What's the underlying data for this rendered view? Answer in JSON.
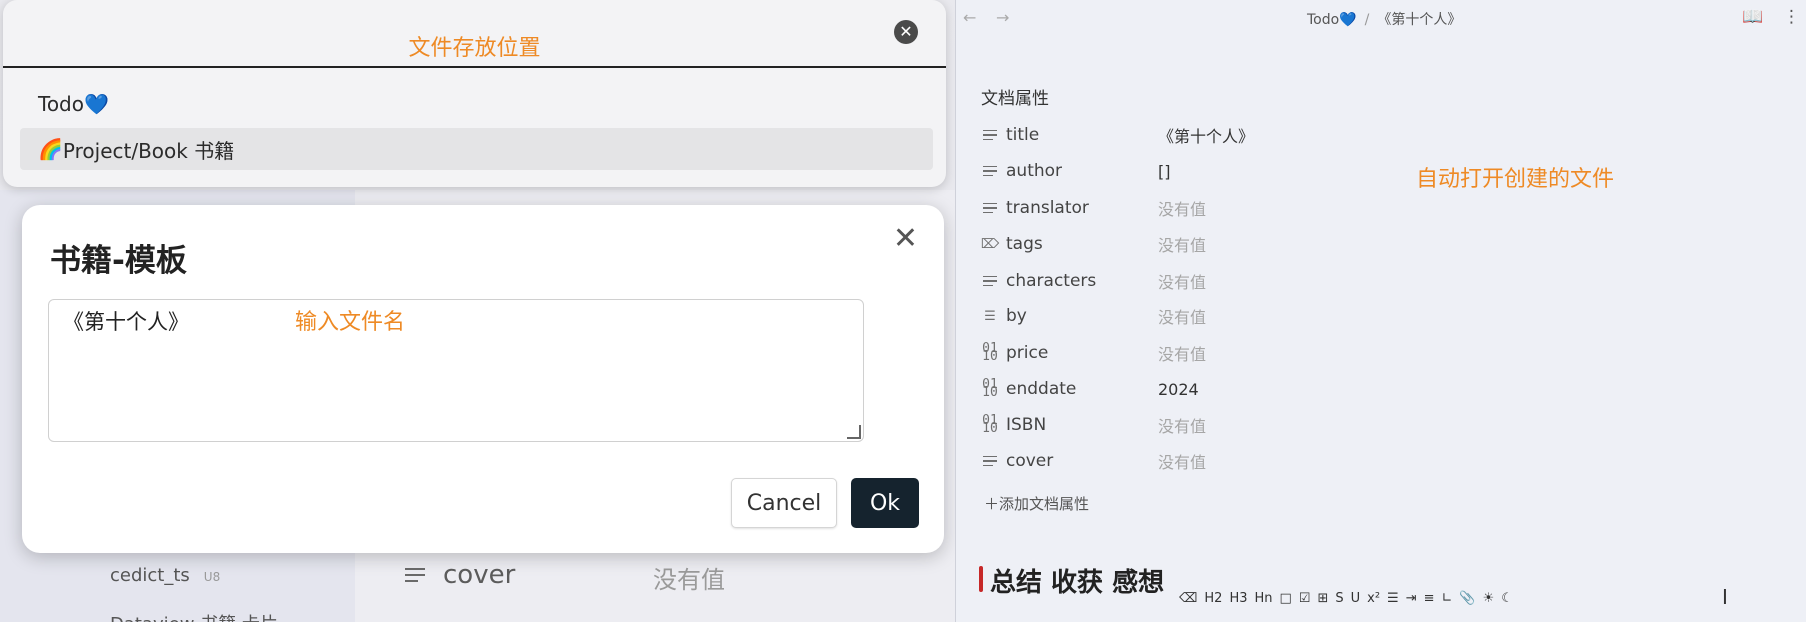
{
  "location_picker": {
    "title": "文件存放位置",
    "items": [
      {
        "label": "Todo",
        "emoji": "💙"
      },
      {
        "label": "Project/Book 书籍",
        "emoji": "🌈"
      }
    ]
  },
  "template_modal": {
    "title": "书籍-模板",
    "filename_value": "《第十个人》",
    "hint": "输入文件名",
    "cancel_label": "Cancel",
    "ok_label": "Ok"
  },
  "background": {
    "file_item_1": "cedict_ts",
    "file_item_1_badge": "U8",
    "file_item_2": "Dataview 书籍 卡片",
    "prop_name": "cover",
    "prop_value": "没有值"
  },
  "right_pane": {
    "breadcrumb": {
      "parent": "Todo💙",
      "separator": "/",
      "current": "《第十个人》"
    },
    "properties_heading": "文档属性",
    "properties": [
      {
        "name": "title",
        "value": "《第十个人》",
        "icon": "text-lines-icon",
        "empty": false
      },
      {
        "name": "author",
        "value": "[]",
        "icon": "text-lines-icon",
        "empty": false
      },
      {
        "name": "translator",
        "value": "没有值",
        "icon": "text-lines-icon",
        "empty": true
      },
      {
        "name": "tags",
        "value": "没有值",
        "icon": "tag-icon",
        "empty": true
      },
      {
        "name": "characters",
        "value": "没有值",
        "icon": "text-lines-icon",
        "empty": true
      },
      {
        "name": "by",
        "value": "没有值",
        "icon": "list-icon",
        "empty": true
      },
      {
        "name": "price",
        "value": "没有值",
        "icon": "number-icon",
        "empty": true
      },
      {
        "name": "enddate",
        "value": "2024",
        "icon": "number-icon",
        "empty": false
      },
      {
        "name": "ISBN",
        "value": "没有值",
        "icon": "number-icon",
        "empty": true
      },
      {
        "name": "cover",
        "value": "没有值",
        "icon": "text-lines-icon",
        "empty": true
      }
    ],
    "add_property_label": "添加文档属性",
    "annotation": "自动打开创建的文件",
    "heading": "总结 收获 感想"
  },
  "colors": {
    "annotation": "#ee8a25",
    "ok_button": "#15232e",
    "heading_bar": "#c62828"
  }
}
